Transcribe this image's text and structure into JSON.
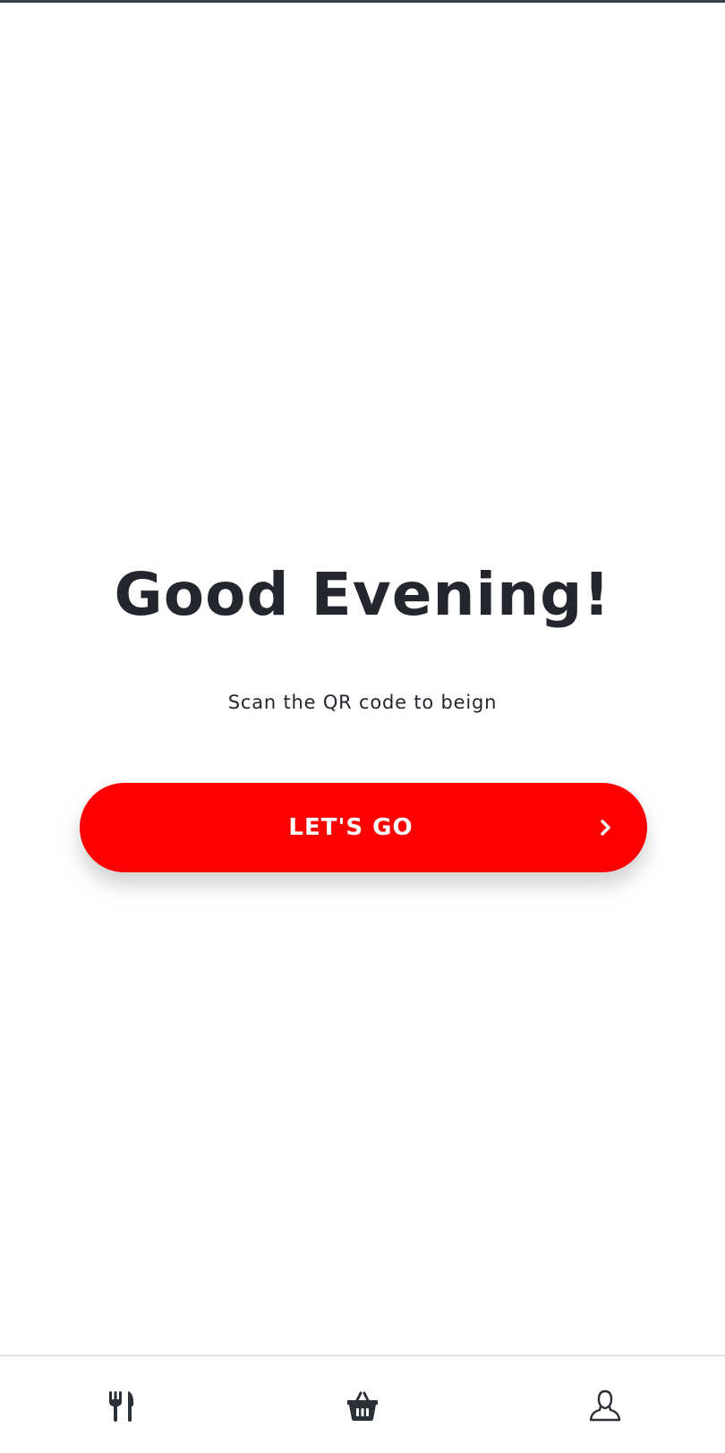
{
  "welcome": {
    "greeting": "Good Evening!",
    "subtitle": "Scan the QR code to beign",
    "cta_label": "LET'S GO"
  },
  "bottom_nav": {
    "items": [
      {
        "icon": "fork-knife-icon",
        "name": "menu"
      },
      {
        "icon": "basket-icon",
        "name": "basket"
      },
      {
        "icon": "user-icon",
        "name": "profile"
      }
    ]
  },
  "colors": {
    "accent": "#ff0000",
    "text": "#24262d",
    "icon": "#2b2f36",
    "background": "#ffffff",
    "nav_border": "#e4e4e4"
  }
}
